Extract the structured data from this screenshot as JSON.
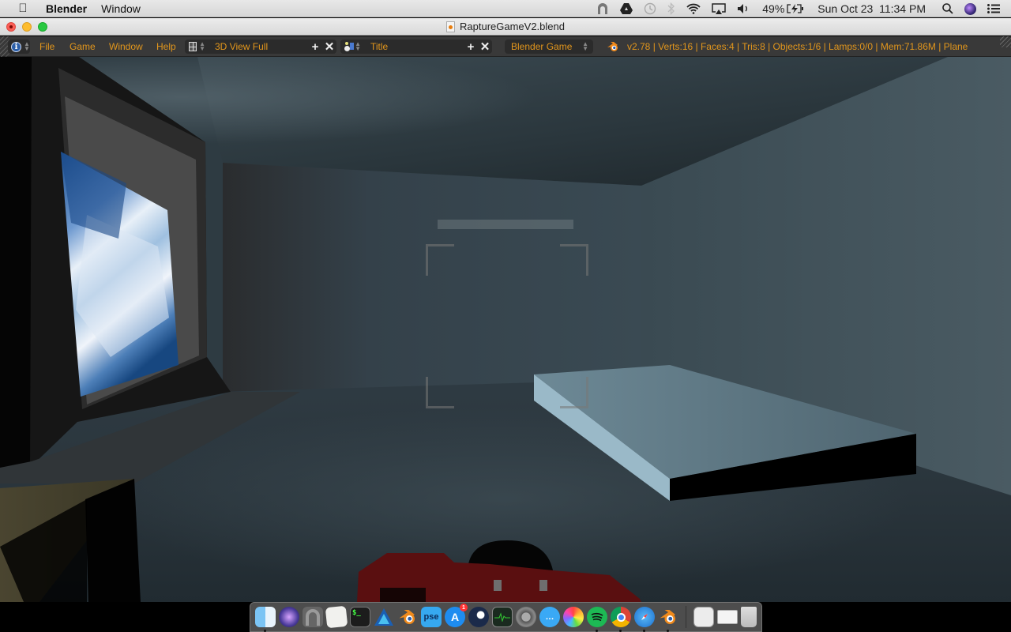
{
  "menubar": {
    "app_name": "Blender",
    "menus": [
      "Window"
    ],
    "status": {
      "battery_percent": "49%",
      "datetime": "Sun Oct 23  11:34 PM"
    }
  },
  "window": {
    "title": "RaptureGameV2.blend"
  },
  "blender_header": {
    "menus": [
      "File",
      "Game",
      "Window",
      "Help"
    ],
    "screen_layout": "3D View Full",
    "scene": "Title",
    "render_engine": "Blender Game",
    "stats": "v2.78 | Verts:16 | Faces:4 | Tris:8 | Objects:1/6 | Lamps:0/0 | Mem:71.86M | Plane"
  },
  "colors": {
    "header_text": "#e2961c",
    "header_bg": "#393939",
    "widget_bg": "#2b2b2b",
    "wall": "#3a4a52",
    "floor": "#26323a",
    "painting_blue": "#1e5592",
    "slab_top": "#58707c",
    "slab_side": "#9ab9c8",
    "gun_red": "#5a0f10"
  },
  "dock": {
    "apps": [
      {
        "name": "Finder",
        "running": true
      },
      {
        "name": "Siri",
        "running": false
      },
      {
        "name": "Tunnelblick",
        "running": false
      },
      {
        "name": "TextEdit",
        "running": false
      },
      {
        "name": "Terminal",
        "running": false
      },
      {
        "name": "Affinity Designer",
        "running": false
      },
      {
        "name": "Blender",
        "running": false
      },
      {
        "name": "Photoshop Elements",
        "label": "pse",
        "running": false
      },
      {
        "name": "App Store",
        "badge": "1",
        "running": false
      },
      {
        "name": "Steam",
        "running": false
      },
      {
        "name": "Activity Monitor",
        "running": false
      },
      {
        "name": "System Preferences",
        "running": false
      },
      {
        "name": "Messages",
        "running": false
      },
      {
        "name": "Photos",
        "running": false
      },
      {
        "name": "Spotify",
        "running": true
      },
      {
        "name": "Chrome",
        "running": true
      },
      {
        "name": "Safari",
        "running": true
      },
      {
        "name": "Blender",
        "running": true
      }
    ],
    "stacks": [
      "Documents",
      "Chrome Apps",
      "Trash"
    ]
  }
}
